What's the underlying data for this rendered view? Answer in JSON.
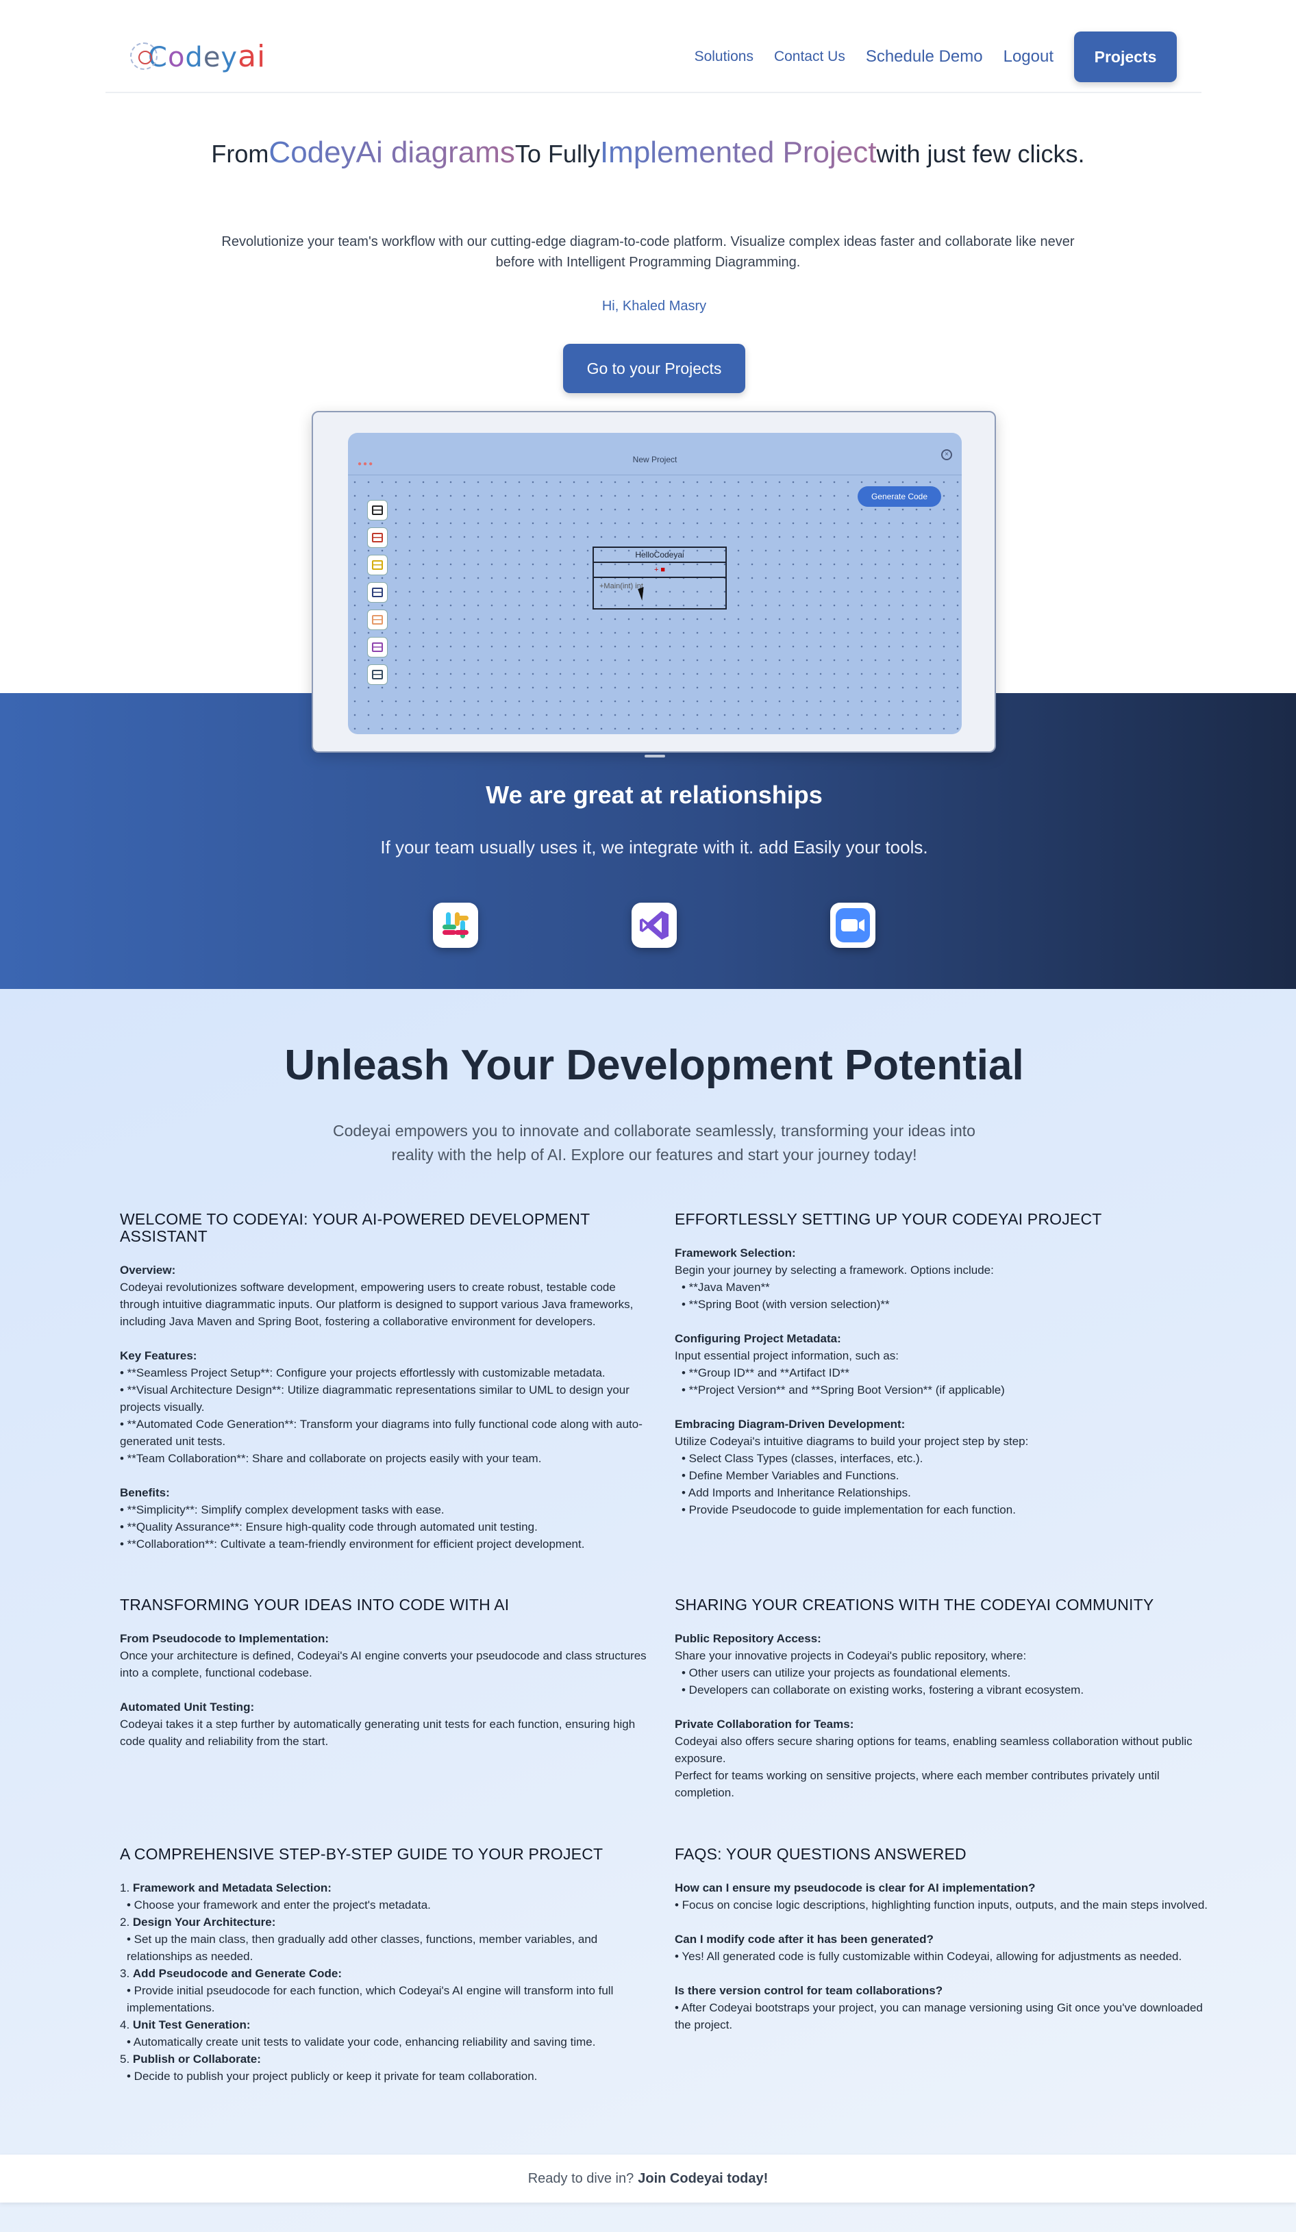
{
  "nav": {
    "logo": {
      "c": "C",
      "o": "o",
      "d": "d",
      "e": "e",
      "y": "y",
      "ai": "ai"
    },
    "links": [
      "Solutions",
      "Contact Us",
      "Schedule Demo",
      "Logout"
    ],
    "projects_button": "Projects"
  },
  "hero": {
    "title_from": "From",
    "title_highlight1": "CodeyAi diagrams",
    "title_mid": "To Fully",
    "title_highlight2": "Implemented Project",
    "title_end": "with just few clicks.",
    "subtitle": "Revolutionize your team's workflow with our cutting-edge diagram-to-code platform. Visualize complex ideas faster and collaborate like never before with Intelligent Programming Diagramming.",
    "greeting": "Hi, Khaled Masry",
    "cta": "Go to your Projects"
  },
  "mock": {
    "window_title": "New Project",
    "generate_button": "Generate Code",
    "class_name": "HelloCodeyai",
    "method_text": "+Main(int) int",
    "palette_colors": [
      "#222222",
      "#c0392b",
      "#d4ac0d",
      "#2c3e7a",
      "#e59866",
      "#8e44ad",
      "#34495e"
    ]
  },
  "band": {
    "title": "We are great at relationships",
    "subtitle": "If your team usually uses it, we integrate with it. add Easily your tools.",
    "tools": [
      "slack-icon",
      "visual-studio-icon",
      "zoom-icon"
    ]
  },
  "features": {
    "title": "Unleash Your Development Potential",
    "subtitle": "Codeyai empowers you to innovate and collaborate seamlessly, transforming your ideas into reality with the help of AI. Explore our features and start your journey today!",
    "cards": [
      {
        "title": "WELCOME TO CODEYAI: YOUR AI-POWERED DEVELOPMENT ASSISTANT",
        "blocks": [
          {
            "head": "Overview:",
            "lines": [
              "Codeyai revolutionizes software development, empowering users to create robust, testable code through intuitive diagrammatic inputs. Our platform is designed to support various Java frameworks, including Java Maven and Spring Boot, fostering a collaborative environment for developers."
            ]
          },
          {
            "head": "Key Features:",
            "lines": [
              "• **Seamless Project Setup**: Configure your projects effortlessly with customizable metadata.",
              "• **Visual Architecture Design**: Utilize diagrammatic representations similar to UML to design your projects visually.",
              "• **Automated Code Generation**: Transform your diagrams into fully functional code along with auto-generated unit tests.",
              "• **Team Collaboration**: Share and collaborate on projects easily with your team."
            ]
          },
          {
            "head": "Benefits:",
            "lines": [
              "• **Simplicity**: Simplify complex development tasks with ease.",
              "• **Quality Assurance**: Ensure high-quality code through automated unit testing.",
              "• **Collaboration**: Cultivate a team-friendly environment for efficient project development."
            ]
          }
        ]
      },
      {
        "title": "EFFORTLESSLY SETTING UP YOUR CODEYAI PROJECT",
        "blocks": [
          {
            "head": "Framework Selection:",
            "lines": [
              "Begin your journey by selecting a framework. Options include:",
              "  • **Java Maven**",
              "  • **Spring Boot (with version selection)**"
            ]
          },
          {
            "head": "Configuring Project Metadata:",
            "lines": [
              "Input essential project information, such as:",
              "  • **Group ID** and **Artifact ID**",
              "  • **Project Version** and **Spring Boot Version** (if applicable)"
            ]
          },
          {
            "head": "Embracing Diagram-Driven Development:",
            "lines": [
              "Utilize Codeyai's intuitive diagrams to build your project step by step:",
              "  • Select Class Types (classes, interfaces, etc.).",
              "  • Define Member Variables and Functions.",
              "  • Add Imports and Inheritance Relationships.",
              "  • Provide Pseudocode to guide implementation for each function."
            ]
          }
        ]
      },
      {
        "title": "TRANSFORMING YOUR IDEAS INTO CODE WITH AI",
        "blocks": [
          {
            "head": "From Pseudocode to Implementation:",
            "lines": [
              "Once your architecture is defined, Codeyai's AI engine converts your pseudocode and class structures into a complete, functional codebase."
            ]
          },
          {
            "head": "Automated Unit Testing:",
            "lines": [
              "Codeyai takes it a step further by automatically generating unit tests for each function, ensuring high code quality and reliability from the start."
            ]
          }
        ]
      },
      {
        "title": "SHARING YOUR CREATIONS WITH THE CODEYAI COMMUNITY",
        "blocks": [
          {
            "head": "Public Repository Access:",
            "lines": [
              "Share your innovative projects in Codeyai's public repository, where:",
              "  • Other users can utilize your projects as foundational elements.",
              "  • Developers can collaborate on existing works, fostering a vibrant ecosystem."
            ]
          },
          {
            "head": "Private Collaboration for Teams:",
            "lines": [
              "Codeyai also offers secure sharing options for teams, enabling seamless collaboration without public exposure.",
              "Perfect for teams working on sensitive projects, where each member contributes privately until completion."
            ]
          }
        ]
      },
      {
        "title": "A COMPREHENSIVE STEP-BY-STEP GUIDE TO YOUR PROJECT",
        "blocks": [
          {
            "head": "",
            "lines": [
              "1. §Framework and Metadata Selection:",
              "  • Choose your framework and enter the project's metadata.",
              "2. §Design Your Architecture:",
              "  • Set up the main class, then gradually add other classes, functions, member variables, and relationships as needed.",
              "3. §Add Pseudocode and Generate Code:",
              "  • Provide initial pseudocode for each function, which Codeyai's AI engine will transform into full implementations.",
              "4. §Unit Test Generation:",
              "  • Automatically create unit tests to validate your code, enhancing reliability and saving time.",
              "5. §Publish or Collaborate:",
              "  • Decide to publish your project publicly or keep it private for team collaboration."
            ]
          }
        ]
      },
      {
        "title": "FAQS: YOUR QUESTIONS ANSWERED",
        "blocks": [
          {
            "head": "How can I ensure my pseudocode is clear for AI implementation?",
            "lines": [
              "• Focus on concise logic descriptions, highlighting function inputs, outputs, and the main steps involved."
            ]
          },
          {
            "head": "Can I modify code after it has been generated?",
            "lines": [
              "• Yes! All generated code is fully customizable within Codeyai, allowing for adjustments as needed."
            ]
          },
          {
            "head": "Is there version control for team collaborations?",
            "lines": [
              "• After Codeyai bootstraps your project, you can manage versioning using Git once you've downloaded the project."
            ]
          }
        ]
      }
    ]
  },
  "footer": {
    "prompt": "Ready to dive in?",
    "cta": "Join Codeyai today!"
  }
}
